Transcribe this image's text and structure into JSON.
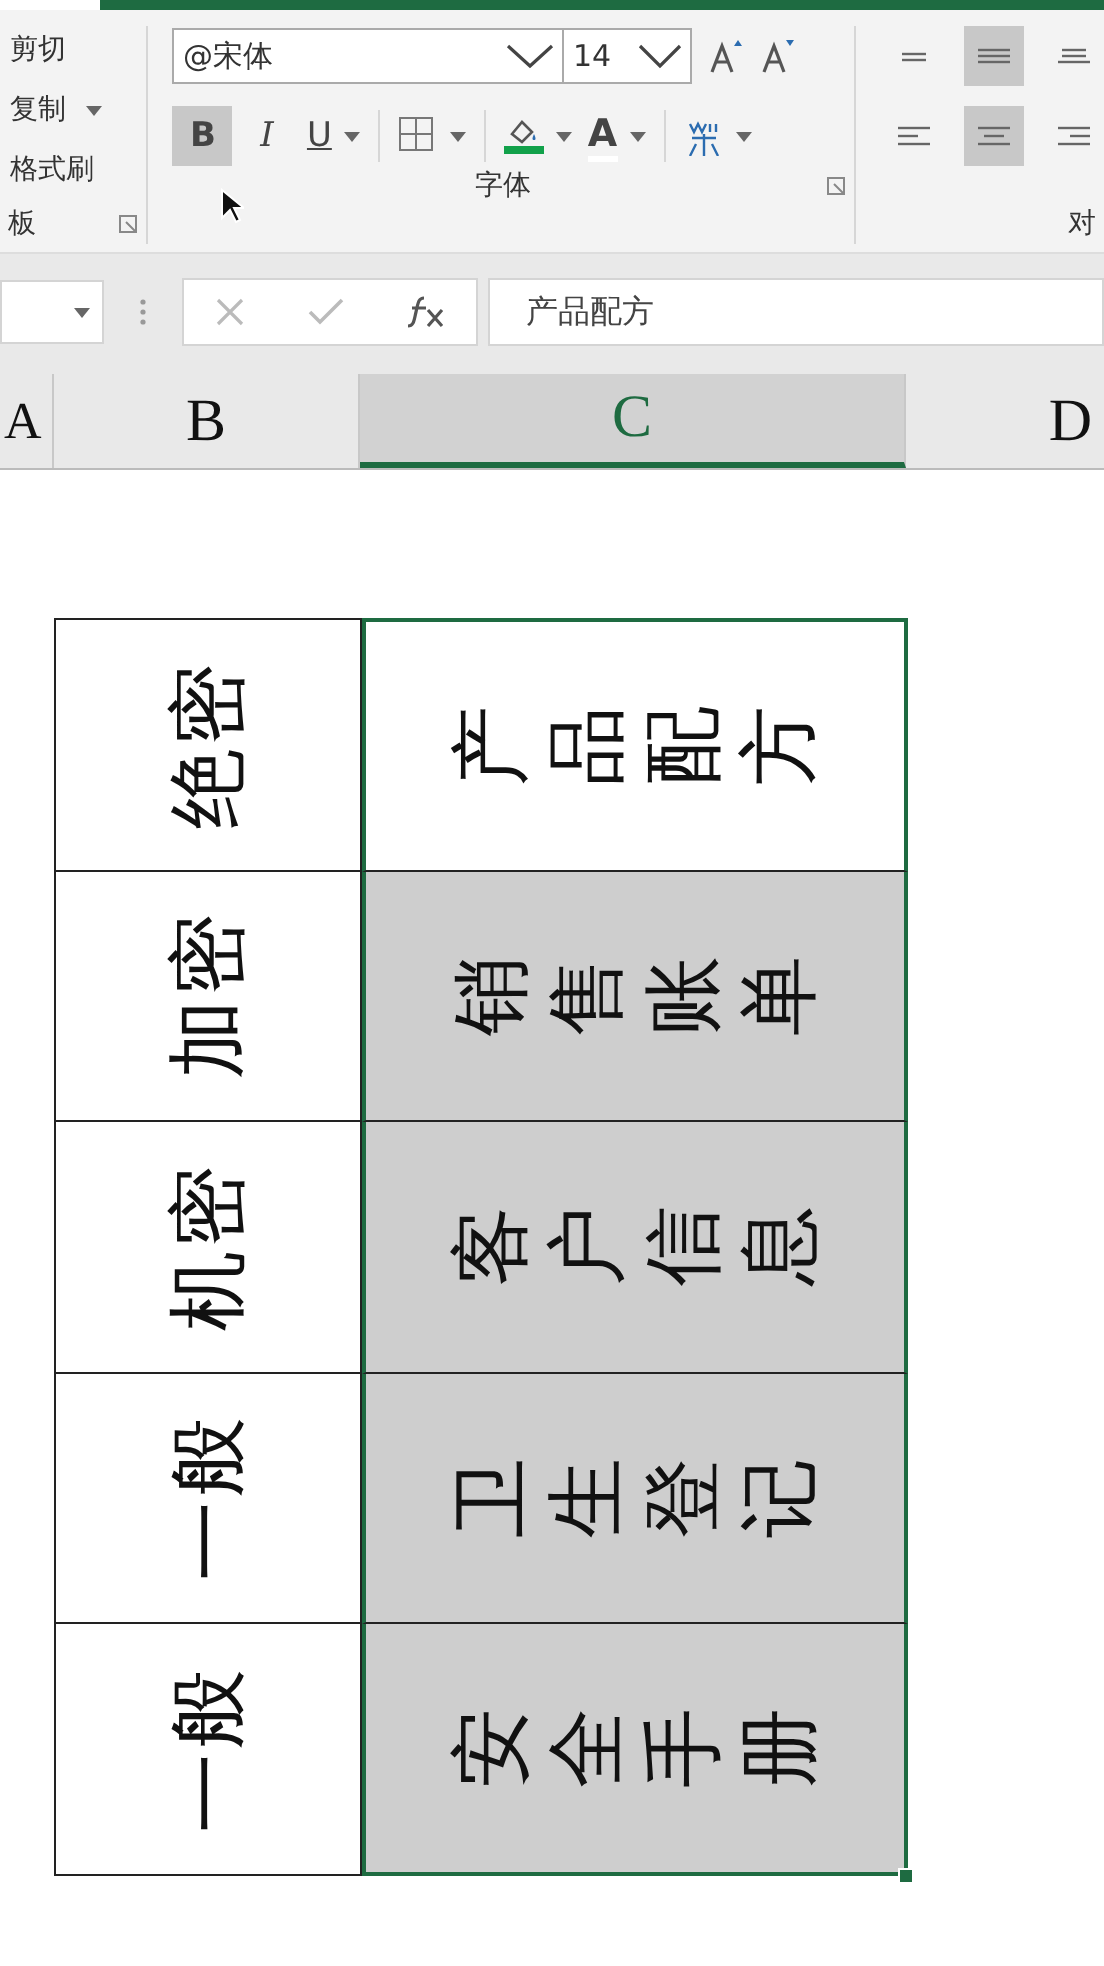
{
  "clipboard": {
    "items": [
      {
        "label": "剪切"
      },
      {
        "label": "复制",
        "dropdown": true
      },
      {
        "label": "格式刷"
      }
    ],
    "group_label": "板"
  },
  "font": {
    "family": "@宋体",
    "size": "14",
    "group_label": "字体",
    "buttons": [
      {
        "kind": "bold",
        "label": "B",
        "selected": true
      },
      {
        "kind": "italic",
        "label": "I",
        "selected": false
      },
      {
        "kind": "underline",
        "label": "U",
        "selected": false
      },
      {
        "kind": "borders",
        "selected": false
      },
      {
        "kind": "fill",
        "selected": false
      },
      {
        "kind": "fontcolor",
        "label": "A",
        "selected": false
      },
      {
        "kind": "phonetic",
        "selected": false
      }
    ]
  },
  "alignment": {
    "group_label": "对",
    "buttons": [
      {
        "kind": "top",
        "selected": false
      },
      {
        "kind": "middle",
        "selected": true
      },
      {
        "kind": "bottom",
        "selected": false
      },
      {
        "kind": "left",
        "selected": false
      },
      {
        "kind": "center",
        "selected": true
      },
      {
        "kind": "right",
        "selected": false
      }
    ]
  },
  "formula_bar": {
    "value": "产品配方"
  },
  "columns": [
    {
      "label": "A",
      "selected": false
    },
    {
      "label": "B",
      "selected": false
    },
    {
      "label": "C",
      "selected": true
    },
    {
      "label": "D",
      "selected": false
    }
  ],
  "rows": [
    {
      "b": "绝密",
      "c": "产品配方",
      "active": true
    },
    {
      "b": "加密",
      "c": "销售账单",
      "active": false
    },
    {
      "b": "机密",
      "c": "客户信息",
      "active": false
    },
    {
      "b": "一般",
      "c": "卫生登记",
      "active": false
    },
    {
      "b": "一般",
      "c": "安全手册",
      "active": false
    }
  ]
}
